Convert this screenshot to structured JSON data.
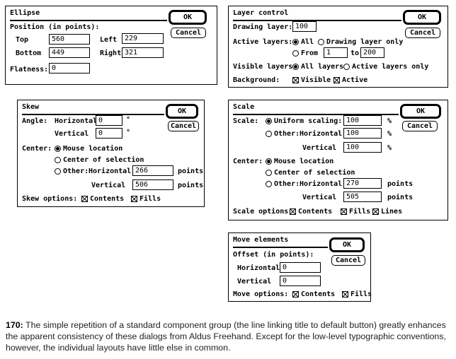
{
  "ellipse": {
    "title": "Ellipse",
    "ok": "OK",
    "cancel": "Cancel",
    "position_label": "Position (in points):",
    "top_label": "Top",
    "top_value": "560",
    "left_label": "Left",
    "left_value": "229",
    "bottom_label": "Bottom",
    "bottom_value": "449",
    "right_label": "Right",
    "right_value": "321",
    "flatness_label": "Flatness:",
    "flatness_value": "0"
  },
  "layer": {
    "title": "Layer control",
    "ok": "OK",
    "cancel": "Cancel",
    "drawing_label": "Drawing layer:",
    "drawing_value": "100",
    "active_label": "Active layers:",
    "all": "All",
    "drawing_only": "Drawing layer only",
    "from": "From",
    "from_value": "1",
    "to": "to",
    "to_value": "200",
    "visible_label": "Visible layers:",
    "all_layers": "All layers",
    "active_only": "Active layers only",
    "background_label": "Background:",
    "bg_visible": "Visible",
    "bg_active": "Active"
  },
  "skew": {
    "title": "Skew",
    "ok": "OK",
    "cancel": "Cancel",
    "angle_label": "Angle:",
    "horizontal": "Horizontal",
    "horizontal_value": "0",
    "vertical": "Vertical",
    "vertical_value": "0",
    "degree": "°",
    "center_label": "Center:",
    "mouse_location": "Mouse location",
    "center_selection": "Center of selection",
    "other": "Other:",
    "other_horizontal": "Horizontal",
    "other_h_value": "266",
    "points": "points",
    "other_vertical": "Vertical",
    "other_v_value": "506",
    "options_label": "Skew options:",
    "contents": "Contents",
    "fills": "Fills"
  },
  "scale": {
    "title": "Scale",
    "ok": "OK",
    "cancel": "Cancel",
    "scale_label": "Scale:",
    "uniform": "Uniform scaling:",
    "uniform_value": "100",
    "pct": "%",
    "other": "Other:",
    "horizontal": "Horizontal",
    "horizontal_value": "100",
    "vertical": "Vertical",
    "vertical_value": "100",
    "center_label": "Center:",
    "mouse_location": "Mouse location",
    "center_selection": "Center of selection",
    "other_horizontal": "Horizontal",
    "other_h_value": "270",
    "points": "points",
    "other_vertical": "Vertical",
    "other_v_value": "505",
    "options_label": "Scale options:",
    "contents": "Contents",
    "fills": "Fills",
    "lines": "Lines"
  },
  "move": {
    "title": "Move elements",
    "ok": "OK",
    "cancel": "Cancel",
    "offset_label": "Offset (in points):",
    "horizontal": "Horizontal",
    "horizontal_value": "0",
    "vertical": "Vertical",
    "vertical_value": "0",
    "options_label": "Move options:",
    "contents": "Contents",
    "fills": "Fills"
  },
  "caption": {
    "number": "170:",
    "text": "The simple repetition of a standard component group (the line linking title to default button) greatly enhances the apparent consistency of these dialogs from Aldus Freehand. Except for the low-level typographic conventions, however, the individual layouts have little else in common."
  }
}
